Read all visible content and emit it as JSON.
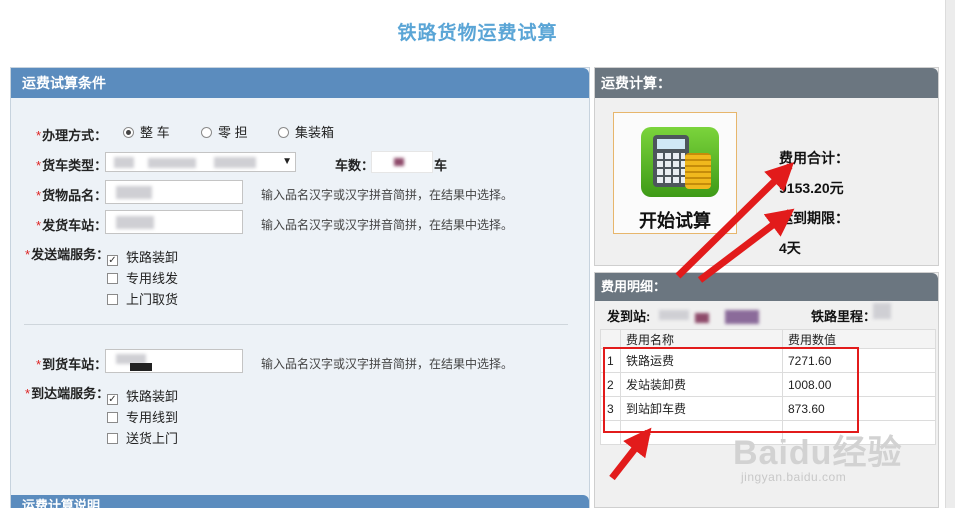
{
  "page": {
    "title": "铁路货物运费试算"
  },
  "conditions": {
    "header": "运费试算条件",
    "handling_label": "办理方式：",
    "handling_options": [
      "整 车",
      "零 担",
      "集装箱"
    ],
    "wagon_type_label": "货车类型：",
    "car_count_label": "车数：",
    "car_unit": "车",
    "goods_label": "货物品名：",
    "goods_hint": "输入品名汉字或汉字拼音简拼，在结果中选择。",
    "from_station_label": "发货车站：",
    "from_station_hint": "输入品名汉字或汉字拼音简拼，在结果中选择。",
    "send_service_label": "发送端服务：",
    "send_services": [
      "铁路装卸",
      "专用线发",
      "上门取货"
    ],
    "to_station_label": "到货车站：",
    "to_station_hint": "输入品名汉字或汉字拼音简拼，在结果中选择。",
    "arrive_service_label": "到达端服务：",
    "arrive_services": [
      "铁路装卸",
      "专用线到",
      "送货上门"
    ],
    "footer_header": "运费计算说明"
  },
  "calc": {
    "header": "运费计算：",
    "button_label": "开始试算",
    "total_label": "费用合计：",
    "total_value": "9153.20元",
    "duration_label": "运到期限：",
    "duration_value": "4天"
  },
  "details": {
    "header": "费用明细：",
    "from_label": "发到站:",
    "distance_label": "铁路里程：",
    "columns": [
      "费用名称",
      "费用数值"
    ],
    "rows": [
      {
        "n": "1",
        "name": "铁路运费",
        "value": "7271.60"
      },
      {
        "n": "2",
        "name": "发站装卸费",
        "value": "1008.00"
      },
      {
        "n": "3",
        "name": "到站卸车费",
        "value": "873.60"
      }
    ]
  },
  "watermark": {
    "brand": "Baidu经验",
    "url": "jingyan.baidu.com"
  },
  "colors": {
    "title": "#5aa5d6",
    "left_header": "#5b8cbe",
    "right_header": "#6b7680",
    "arrow": "#e21b1b"
  },
  "icons": {
    "calculator": "calculator-coins-icon"
  }
}
